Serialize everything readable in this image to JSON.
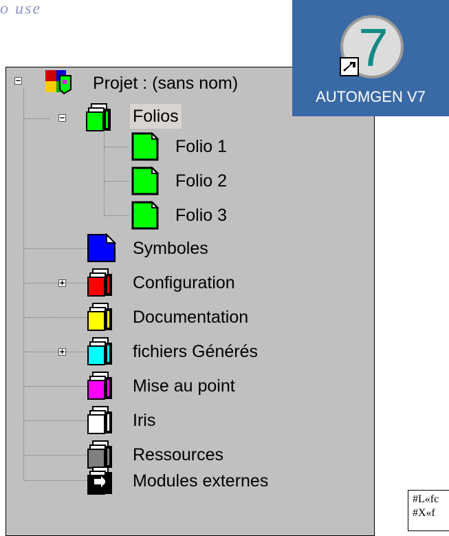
{
  "scribble_text": "o use",
  "tree": {
    "root": {
      "label": "Projet : (sans nom)"
    },
    "folios": {
      "label": "Folios",
      "children": [
        "Folio 1",
        "Folio 2",
        "Folio 3"
      ]
    },
    "items": [
      {
        "label": "Symboles"
      },
      {
        "label": "Configuration"
      },
      {
        "label": "Documentation"
      },
      {
        "label": "fichiers Générés"
      },
      {
        "label": "Mise au point"
      },
      {
        "label": "Iris"
      },
      {
        "label": "Ressources"
      },
      {
        "label": "Modules externes"
      }
    ]
  },
  "shortcut": {
    "label": "AUTOMGEN V7",
    "number": "7",
    "icon": "automgen-app-icon"
  },
  "snippet": {
    "line1": "#L«fc",
    "line2": "#X«f"
  },
  "colors": {
    "panel": "#c0c0c0",
    "desktop": "#3a6aa5",
    "folio": "#00ff00",
    "symboles": "#0000ff",
    "configuration": "#ff0000",
    "documentation": "#ffff00",
    "fichiers": "#00ffff",
    "mise_au_point": "#ff00ff",
    "iris": "#ffffff",
    "ressources": "#808080",
    "modules": "#000000"
  }
}
